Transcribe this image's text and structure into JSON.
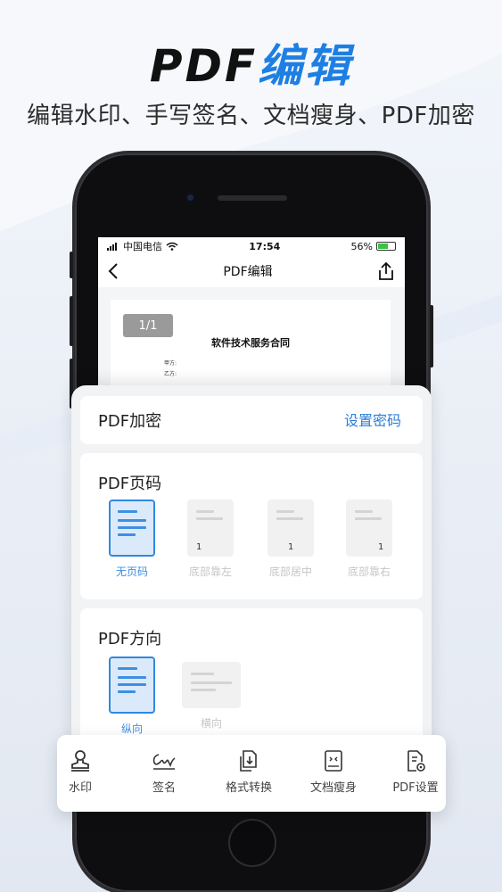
{
  "headline": {
    "dark": "PDF",
    "blue": "编辑"
  },
  "subline": "编辑水印、手写签名、文档瘦身、PDF加密",
  "status_bar": {
    "carrier": "中国电信",
    "time": "17:54",
    "battery": "56%"
  },
  "nav": {
    "title": "PDF编辑"
  },
  "document": {
    "page_badge": "1/1",
    "title": "软件技术服务合同",
    "party_a": "甲方:",
    "party_b": "乙方:"
  },
  "encrypt": {
    "title": "PDF加密",
    "action": "设置密码"
  },
  "page_numbers": {
    "title": "PDF页码",
    "options": [
      {
        "label": "无页码",
        "num": "",
        "selected": true
      },
      {
        "label": "底部靠左",
        "num": "1",
        "selected": false
      },
      {
        "label": "底部居中",
        "num": "1",
        "selected": false
      },
      {
        "label": "底部靠右",
        "num": "1",
        "selected": false
      }
    ]
  },
  "orientation": {
    "title": "PDF方向",
    "options": [
      {
        "label": "纵向",
        "selected": true
      },
      {
        "label": "横向",
        "selected": false
      }
    ]
  },
  "toolbar": {
    "items": [
      {
        "label": "水印",
        "icon": "stamp-icon"
      },
      {
        "label": "签名",
        "icon": "signature-icon"
      },
      {
        "label": "格式转换",
        "icon": "convert-icon"
      },
      {
        "label": "文档瘦身",
        "icon": "compress-icon"
      },
      {
        "label": "PDF设置",
        "icon": "pdf-settings-icon"
      }
    ]
  },
  "colors": {
    "accent": "#1e7fe3",
    "selected_blue": "#2f88e0",
    "disabled_text": "#c6c6c6"
  }
}
